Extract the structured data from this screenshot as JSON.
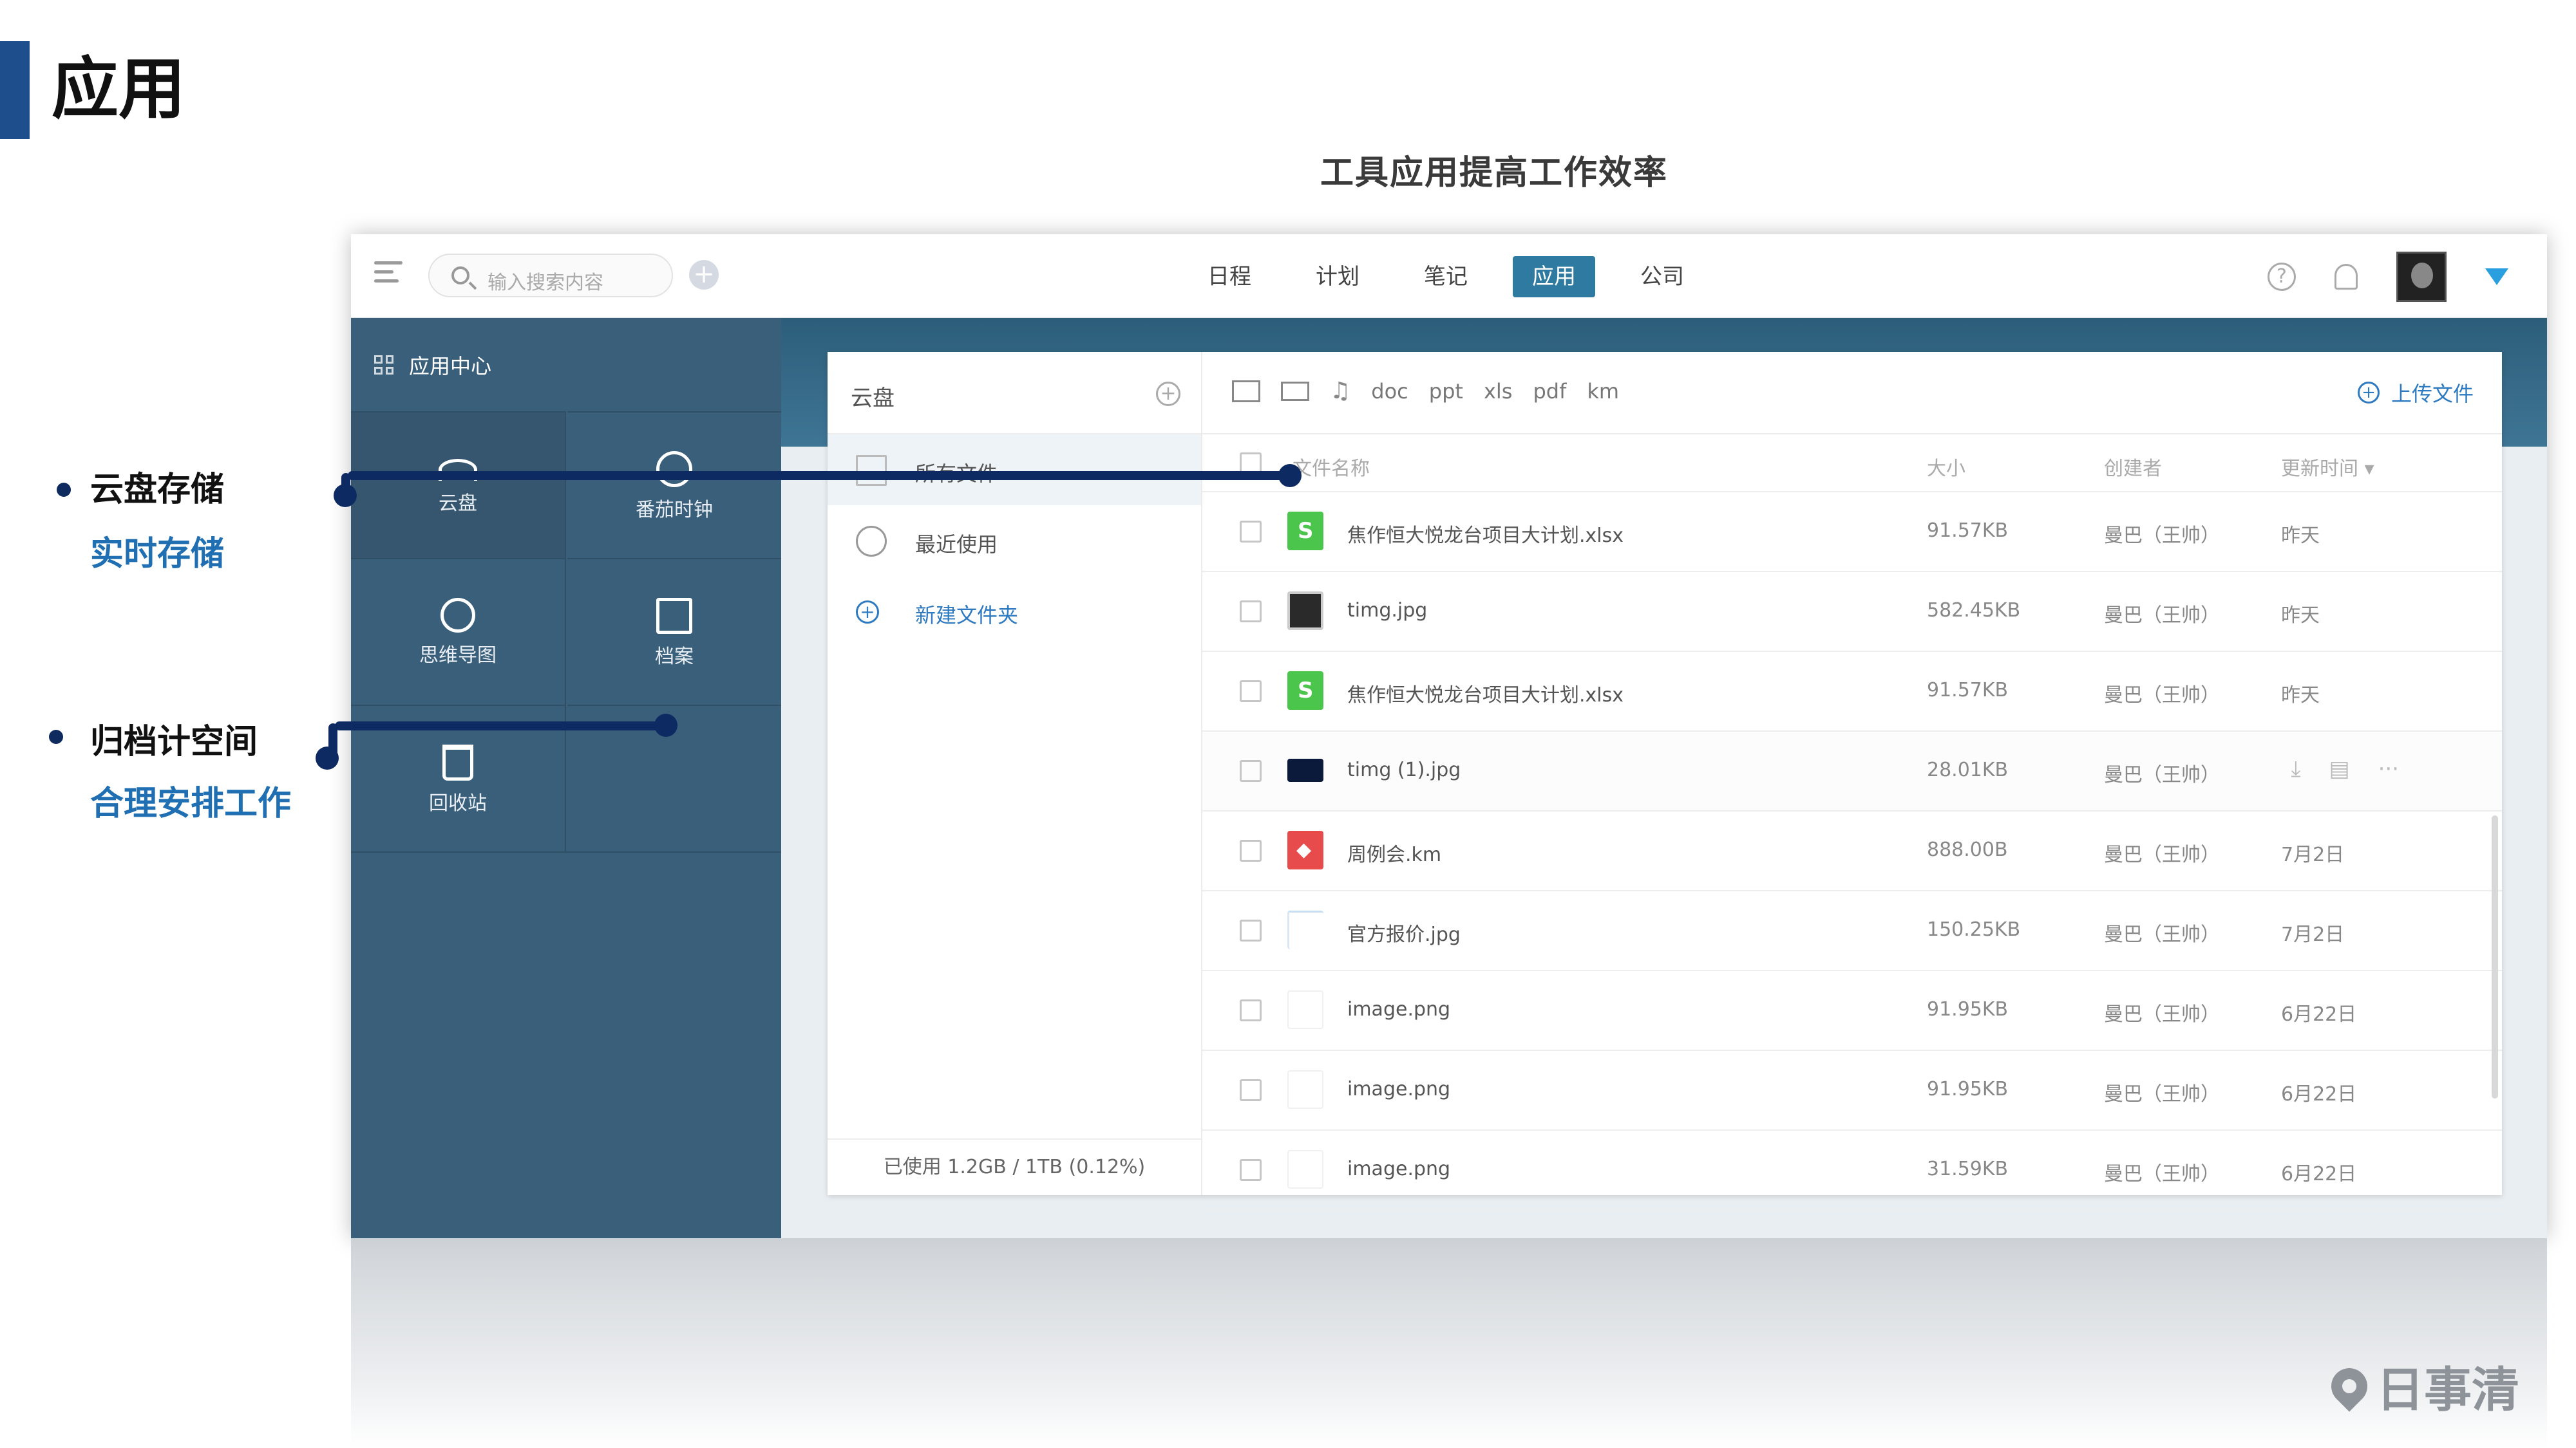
{
  "slide": {
    "title": "应用",
    "subtitle": "工具应用提高工作效率",
    "features": [
      {
        "title": "云盘存储",
        "subtitle": "实时存储"
      },
      {
        "title": "归档计空间",
        "subtitle": "合理安排工作"
      }
    ],
    "watermark": "日事清"
  },
  "topbar": {
    "search_placeholder": "输入搜索内容",
    "add_label": "+",
    "tabs": [
      "日程",
      "计划",
      "笔记",
      "应用",
      "公司"
    ],
    "active_tab": "应用",
    "help_label": "?"
  },
  "sidebar": {
    "header": "应用中心",
    "tiles": [
      "云盘",
      "番茄时钟",
      "思维导图",
      "档案",
      "回收站"
    ]
  },
  "cloud": {
    "title": "云盘",
    "nav": [
      "所有文件",
      "最近使用"
    ],
    "new_folder": "新建文件夹",
    "usage": "已使用 1.2GB / 1TB (0.12%)"
  },
  "filters": {
    "labels": [
      "doc",
      "ppt",
      "xls",
      "pdf",
      "km"
    ],
    "music_glyph": "♫",
    "upload": "上传文件"
  },
  "table": {
    "columns": {
      "name": "文件名称",
      "size": "大小",
      "owner": "创建者",
      "time": "更新时间 ▾"
    },
    "rows": [
      {
        "name": "焦作恒大悦龙台项目大计划.xlsx",
        "size": "91.57KB",
        "owner": "曼巴（王帅）",
        "time": "昨天"
      },
      {
        "name": "timg.jpg",
        "size": "582.45KB",
        "owner": "曼巴（王帅）",
        "time": "昨天"
      },
      {
        "name": "焦作恒大悦龙台项目大计划.xlsx",
        "size": "91.57KB",
        "owner": "曼巴（王帅）",
        "time": "昨天"
      },
      {
        "name": "timg (1).jpg",
        "size": "28.01KB",
        "owner": "曼巴（王帅）",
        "time": ""
      },
      {
        "name": "周例会.km",
        "size": "888.00B",
        "owner": "曼巴（王帅）",
        "time": "7月2日"
      },
      {
        "name": "官方报价.jpg",
        "size": "150.25KB",
        "owner": "曼巴（王帅）",
        "time": "7月2日"
      },
      {
        "name": "image.png",
        "size": "91.95KB",
        "owner": "曼巴（王帅）",
        "time": "6月22日"
      },
      {
        "name": "image.png",
        "size": "91.95KB",
        "owner": "曼巴（王帅）",
        "time": "6月22日"
      },
      {
        "name": "image.png",
        "size": "31.59KB",
        "owner": "曼巴（王帅）",
        "time": "6月22日"
      }
    ],
    "row_actions": [
      "⤓",
      "▤",
      "···"
    ]
  },
  "colors": {
    "accent": "#2e7aa0",
    "sidebar": "#3a5f7a",
    "connector": "#0d2a63",
    "subtitle_blue": "#1f6fb2",
    "xlsx": "#4cc54c",
    "km": "#e84b4b"
  }
}
